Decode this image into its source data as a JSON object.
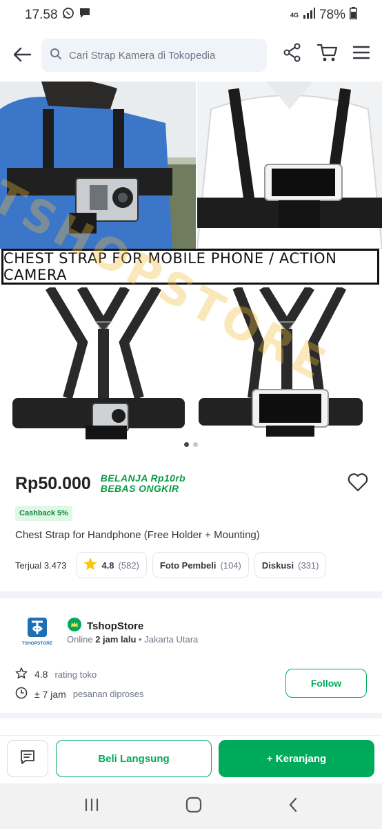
{
  "status_bar": {
    "time": "17.58",
    "network": "4G",
    "battery": "78%"
  },
  "search": {
    "placeholder": "Cari Strap Kamera di Tokopedia"
  },
  "gallery": {
    "banner_text": "CHEST STRAP FOR MOBILE PHONE / ACTION CAMERA",
    "watermark": "TSHOPSTORE",
    "image_count": 2,
    "current_index": 1
  },
  "product": {
    "price": "Rp50.000",
    "promo_line1": "BELANJA Rp10rb",
    "promo_line2": "BEBAS ONGKIR",
    "cashback": "Cashback 5%",
    "title": "Chest Strap for Handphone (Free Holder + Mounting)",
    "sold": "Terjual 3.473",
    "rating": "4.8",
    "rating_count": "(582)",
    "photos_label": "Foto Pembeli",
    "photos_count": "(104)",
    "discussion_label": "Diskusi",
    "discussion_count": "(331)"
  },
  "shop": {
    "logo_text": "TSHOPSTORE",
    "name": "TshopStore",
    "online_prefix": "Online",
    "online_time": "2 jam lalu",
    "location": "• Jakarta Utara",
    "rating": "4.8",
    "rating_label": "rating toko",
    "process_time": "± 7 jam",
    "process_label": "pesanan diproses",
    "follow_label": "Follow"
  },
  "actions": {
    "buy_now": "Beli Langsung",
    "add_cart": "+ Keranjang"
  },
  "colors": {
    "brand_green": "#00aa5b",
    "promo_green": "#0a9a44"
  }
}
